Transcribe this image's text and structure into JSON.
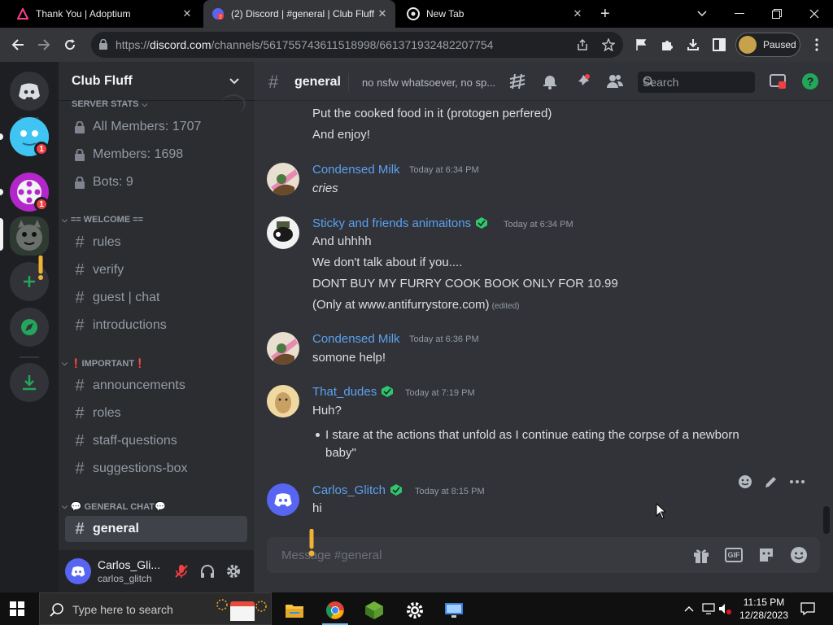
{
  "browser": {
    "tabs": [
      {
        "title": "Thank You | Adoptium",
        "active": false
      },
      {
        "title": "(2) Discord | #general | Club Fluff",
        "active": true
      },
      {
        "title": "New Tab",
        "active": false
      }
    ],
    "url_prefix": "https://",
    "url_host": "discord.com",
    "url_path": "/channels/561755743611518998/661371932482207754",
    "profile_label": "Paused"
  },
  "server": {
    "name": "Club Fluff",
    "guild_badges": [
      "1",
      "1"
    ],
    "categories": {
      "stats": "SERVER STATS",
      "welcome": "== WELCOME ==",
      "important": "❗IMPORTANT❗",
      "general_chat": "💬 GENERAL CHAT💬"
    },
    "stat_channels": [
      "All Members: 1707",
      "Members: 1698",
      "Bots: 9"
    ],
    "welcome_channels": [
      "rules",
      "verify",
      "guest | chat",
      "introductions"
    ],
    "important_channels": [
      "announcements",
      "roles",
      "staff-questions",
      "suggestions-box"
    ],
    "general_channels": [
      "general"
    ]
  },
  "user": {
    "display_name": "Carlos_Gli...",
    "tag": "carlos_glitch"
  },
  "channel": {
    "name": "general",
    "topic": "no nsfw whatsoever, no sp...",
    "search_placeholder": "Search"
  },
  "messages": {
    "top_lines": [
      "Put the cooked food in it (protogen perfered)",
      "And enjoy!"
    ],
    "m1": {
      "author": "Condensed Milk",
      "time": "Today at 6:34 PM",
      "text": "cries"
    },
    "m2": {
      "author": "Sticky and friends animaitons",
      "time": "Today at 6:34 PM",
      "lines": [
        "And uhhhh",
        "We don't talk about if you....",
        "DONT BUY MY FURRY COOK BOOK ONLY FOR 10.99",
        "(Only at www.antifurrystore.com)"
      ],
      "edited": "(edited)"
    },
    "m3": {
      "author": "Condensed Milk",
      "time": "Today at 6:36 PM",
      "text": "somone help!"
    },
    "m4": {
      "author": "That_dudes",
      "time": "Today at 7:19 PM",
      "text": "Huh?",
      "bullet_lines": [
        "I stare at the actions that unfold as I continue eating the corpse of a newborn",
        "baby\""
      ]
    },
    "m5": {
      "author": "Carlos_Glitch",
      "time": "Today at 8:15 PM",
      "text": "hi"
    }
  },
  "composer": {
    "placeholder": "Message #general",
    "gif_label": "GIF"
  },
  "taskbar": {
    "search_placeholder": "Type here to search",
    "time": "11:15 PM",
    "date": "12/28/2023"
  },
  "colors": {
    "accent_link": "#5ba1ef",
    "badge_red": "#f23f43",
    "role_green": "#2dc770",
    "blurple": "#5865f2"
  }
}
